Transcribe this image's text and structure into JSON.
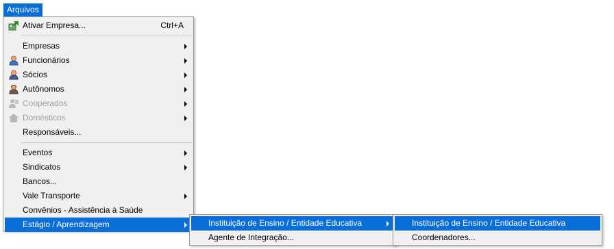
{
  "menubar": {
    "arquivos_label": "Arquivos"
  },
  "main_menu": {
    "ativar_empresa": {
      "label": "Ativar Empresa...",
      "shortcut": "Ctrl+A",
      "icon": "activate-company-icon"
    },
    "group1": [
      {
        "label": "Empresas",
        "icon": "",
        "has_submenu": true,
        "disabled": false
      },
      {
        "label": "Funcionários",
        "icon": "employee-person-icon",
        "has_submenu": true,
        "disabled": false
      },
      {
        "label": "Sócios",
        "icon": "partner-person-icon",
        "has_submenu": true,
        "disabled": false
      },
      {
        "label": "Autônomos",
        "icon": "freelancer-person-icon",
        "has_submenu": true,
        "disabled": false
      },
      {
        "label": "Cooperados",
        "icon": "cooperative-icon",
        "has_submenu": true,
        "disabled": true
      },
      {
        "label": "Domésticos",
        "icon": "domestic-house-icon",
        "has_submenu": true,
        "disabled": true
      },
      {
        "label": "Responsáveis...",
        "icon": "",
        "has_submenu": false,
        "disabled": false
      }
    ],
    "group2": [
      {
        "label": "Eventos",
        "has_submenu": true
      },
      {
        "label": "Sindicatos",
        "has_submenu": true
      },
      {
        "label": "Bancos...",
        "has_submenu": false
      },
      {
        "label": "Vale Transporte",
        "has_submenu": true
      },
      {
        "label": "Convênios - Assistência à Saúde",
        "has_submenu": false
      },
      {
        "label": "Estágio / Aprendizagem",
        "has_submenu": true,
        "highlighted": true
      }
    ]
  },
  "submenu_estagio": {
    "items": [
      {
        "label": "Instituição de Ensino / Entidade Educativa",
        "has_submenu": true,
        "highlighted": true
      },
      {
        "label": "Agente de Integração...",
        "has_submenu": false
      }
    ]
  },
  "submenu_instituicao": {
    "items": [
      {
        "label": "Instituição de Ensino / Entidade Educativa",
        "highlighted": true
      },
      {
        "label": "Coordenadores..."
      }
    ]
  },
  "colors": {
    "highlight": "#0a6ed8",
    "menu_bg": "#f0f0f0",
    "disabled_text": "#9e9e9e"
  }
}
